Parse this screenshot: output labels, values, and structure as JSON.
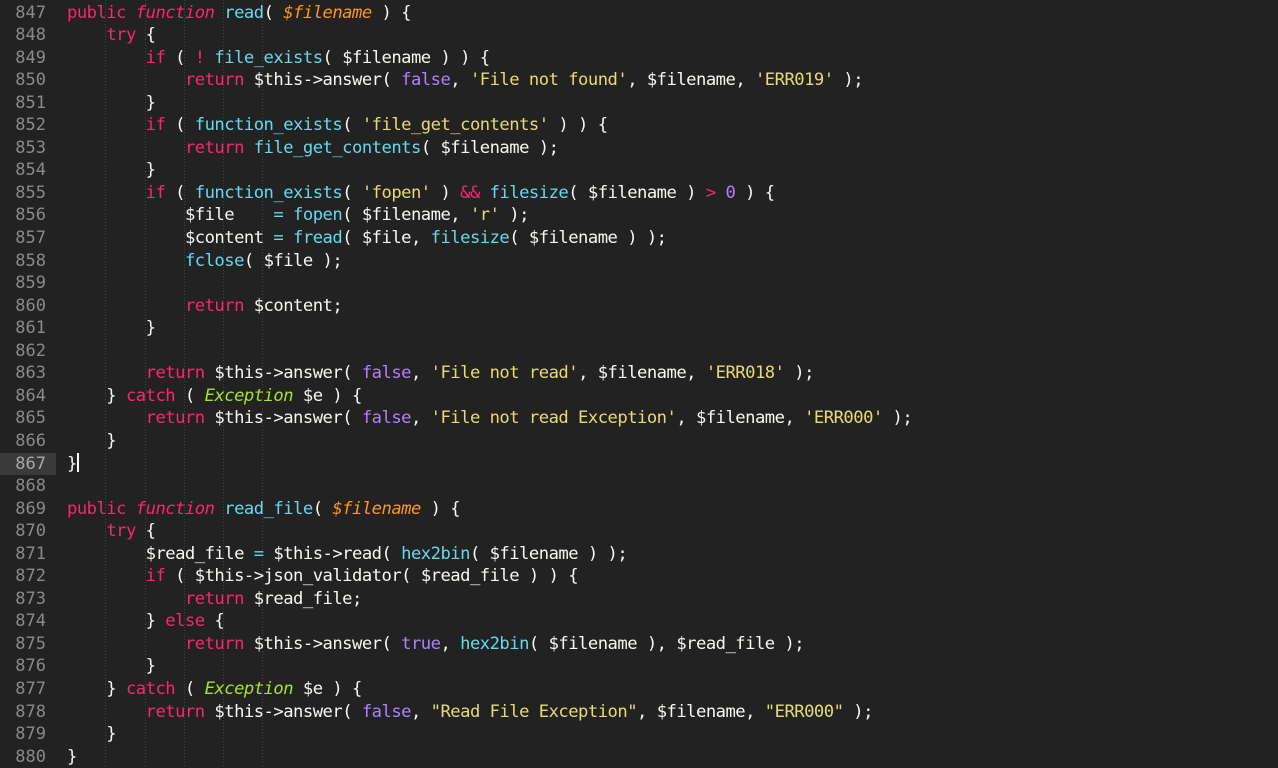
{
  "editor": {
    "background_color": "#222222",
    "gutter_text_color": "#8a8a8a",
    "active_line_background": "#3a3a3a",
    "default_text_color": "#f8f8f2",
    "language": "PHP",
    "first_line_number": 847,
    "last_line_number": 880,
    "active_line_number": 867,
    "cursor_line": 867,
    "cursor_column": 2,
    "palette": {
      "keyword": "#f92672",
      "function_name": "#66d9ef",
      "string": "#e6db74",
      "constant": "#ae81ff",
      "class_name": "#a6e22e",
      "parameter": "#fd971f",
      "punctuation": "#f8f8f2"
    },
    "indent_guide_columns": [
      4,
      8,
      12,
      16,
      20
    ]
  },
  "code": {
    "lines": [
      {
        "num": "847",
        "text": "public function read( $filename ) {"
      },
      {
        "num": "848",
        "text": "    try {"
      },
      {
        "num": "849",
        "text": "        if ( ! file_exists( $filename ) ) {"
      },
      {
        "num": "850",
        "text": "            return $this->answer( false, 'File not found', $filename, 'ERR019' );"
      },
      {
        "num": "851",
        "text": "        }"
      },
      {
        "num": "852",
        "text": "        if ( function_exists( 'file_get_contents' ) ) {"
      },
      {
        "num": "853",
        "text": "            return file_get_contents( $filename );"
      },
      {
        "num": "854",
        "text": "        }"
      },
      {
        "num": "855",
        "text": "        if ( function_exists( 'fopen' ) && filesize( $filename ) > 0 ) {"
      },
      {
        "num": "856",
        "text": "            $file    = fopen( $filename, 'r' );"
      },
      {
        "num": "857",
        "text": "            $content = fread( $file, filesize( $filename ) );"
      },
      {
        "num": "858",
        "text": "            fclose( $file );"
      },
      {
        "num": "859",
        "text": ""
      },
      {
        "num": "860",
        "text": "            return $content;"
      },
      {
        "num": "861",
        "text": "        }"
      },
      {
        "num": "862",
        "text": ""
      },
      {
        "num": "863",
        "text": "        return $this->answer( false, 'File not read', $filename, 'ERR018' );"
      },
      {
        "num": "864",
        "text": "    } catch ( Exception $e ) {"
      },
      {
        "num": "865",
        "text": "        return $this->answer( false, 'File not read Exception', $filename, 'ERR000' );"
      },
      {
        "num": "866",
        "text": "    }"
      },
      {
        "num": "867",
        "text": "}"
      },
      {
        "num": "868",
        "text": ""
      },
      {
        "num": "869",
        "text": "public function read_file( $filename ) {"
      },
      {
        "num": "870",
        "text": "    try {"
      },
      {
        "num": "871",
        "text": "        $read_file = $this->read( hex2bin( $filename ) );"
      },
      {
        "num": "872",
        "text": "        if ( $this->json_validator( $read_file ) ) {"
      },
      {
        "num": "873",
        "text": "            return $read_file;"
      },
      {
        "num": "874",
        "text": "        } else {"
      },
      {
        "num": "875",
        "text": "            return $this->answer( true, hex2bin( $filename ), $read_file );"
      },
      {
        "num": "876",
        "text": "        }"
      },
      {
        "num": "877",
        "text": "    } catch ( Exception $e ) {"
      },
      {
        "num": "878",
        "text": "        return $this->answer( false, \"Read File Exception\", $filename, \"ERR000\" );"
      },
      {
        "num": "879",
        "text": "    }"
      },
      {
        "num": "880",
        "text": "}"
      }
    ],
    "tokens": [
      [
        [
          "kw",
          "public"
        ],
        [
          "pun",
          " "
        ],
        [
          "fnkw",
          "function"
        ],
        [
          "pun",
          " "
        ],
        [
          "fn",
          "read"
        ],
        [
          "pun",
          "( "
        ],
        [
          "param",
          "$filename"
        ],
        [
          "pun",
          " ) {"
        ]
      ],
      [
        [
          "pun",
          "    "
        ],
        [
          "kw",
          "try"
        ],
        [
          "pun",
          " {"
        ]
      ],
      [
        [
          "pun",
          "        "
        ],
        [
          "kw",
          "if"
        ],
        [
          "pun",
          " ( "
        ],
        [
          "op",
          "!"
        ],
        [
          "pun",
          " "
        ],
        [
          "fn",
          "file_exists"
        ],
        [
          "pun",
          "( "
        ],
        [
          "var",
          "$filename"
        ],
        [
          "pun",
          " ) ) {"
        ]
      ],
      [
        [
          "pun",
          "            "
        ],
        [
          "kw",
          "return"
        ],
        [
          "pun",
          " "
        ],
        [
          "var",
          "$this->answer"
        ],
        [
          "pun",
          "( "
        ],
        [
          "const",
          "false"
        ],
        [
          "pun",
          ", "
        ],
        [
          "str",
          "'File not found'"
        ],
        [
          "pun",
          ", "
        ],
        [
          "var",
          "$filename"
        ],
        [
          "pun",
          ", "
        ],
        [
          "str",
          "'ERR019'"
        ],
        [
          "pun",
          " );"
        ]
      ],
      [
        [
          "pun",
          "        }"
        ]
      ],
      [
        [
          "pun",
          "        "
        ],
        [
          "kw",
          "if"
        ],
        [
          "pun",
          " ( "
        ],
        [
          "fn",
          "function_exists"
        ],
        [
          "pun",
          "( "
        ],
        [
          "str",
          "'file_get_contents'"
        ],
        [
          "pun",
          " ) ) {"
        ]
      ],
      [
        [
          "pun",
          "            "
        ],
        [
          "kw",
          "return"
        ],
        [
          "pun",
          " "
        ],
        [
          "fn",
          "file_get_contents"
        ],
        [
          "pun",
          "( "
        ],
        [
          "var",
          "$filename"
        ],
        [
          "pun",
          " );"
        ]
      ],
      [
        [
          "pun",
          "        }"
        ]
      ],
      [
        [
          "pun",
          "        "
        ],
        [
          "kw",
          "if"
        ],
        [
          "pun",
          " ( "
        ],
        [
          "fn",
          "function_exists"
        ],
        [
          "pun",
          "( "
        ],
        [
          "str",
          "'fopen'"
        ],
        [
          "pun",
          " ) "
        ],
        [
          "op",
          "&&"
        ],
        [
          "pun",
          " "
        ],
        [
          "fn",
          "filesize"
        ],
        [
          "pun",
          "( "
        ],
        [
          "var",
          "$filename"
        ],
        [
          "pun",
          " ) "
        ],
        [
          "op",
          ">"
        ],
        [
          "pun",
          " "
        ],
        [
          "const",
          "0"
        ],
        [
          "pun",
          " ) {"
        ]
      ],
      [
        [
          "pun",
          "            "
        ],
        [
          "var",
          "$file"
        ],
        [
          "pun",
          "    "
        ],
        [
          "eq",
          "="
        ],
        [
          "pun",
          " "
        ],
        [
          "fn",
          "fopen"
        ],
        [
          "pun",
          "( "
        ],
        [
          "var",
          "$filename"
        ],
        [
          "pun",
          ", "
        ],
        [
          "str",
          "'r'"
        ],
        [
          "pun",
          " );"
        ]
      ],
      [
        [
          "pun",
          "            "
        ],
        [
          "var",
          "$content"
        ],
        [
          "pun",
          " "
        ],
        [
          "eq",
          "="
        ],
        [
          "pun",
          " "
        ],
        [
          "fn",
          "fread"
        ],
        [
          "pun",
          "( "
        ],
        [
          "var",
          "$file"
        ],
        [
          "pun",
          ", "
        ],
        [
          "fn",
          "filesize"
        ],
        [
          "pun",
          "( "
        ],
        [
          "var",
          "$filename"
        ],
        [
          "pun",
          " ) );"
        ]
      ],
      [
        [
          "pun",
          "            "
        ],
        [
          "fn",
          "fclose"
        ],
        [
          "pun",
          "( "
        ],
        [
          "var",
          "$file"
        ],
        [
          "pun",
          " );"
        ]
      ],
      [
        [
          "pun",
          ""
        ]
      ],
      [
        [
          "pun",
          "            "
        ],
        [
          "kw",
          "return"
        ],
        [
          "pun",
          " "
        ],
        [
          "var",
          "$content"
        ],
        [
          "pun",
          ";"
        ]
      ],
      [
        [
          "pun",
          "        }"
        ]
      ],
      [
        [
          "pun",
          ""
        ]
      ],
      [
        [
          "pun",
          "        "
        ],
        [
          "kw",
          "return"
        ],
        [
          "pun",
          " "
        ],
        [
          "var",
          "$this->answer"
        ],
        [
          "pun",
          "( "
        ],
        [
          "const",
          "false"
        ],
        [
          "pun",
          ", "
        ],
        [
          "str",
          "'File not read'"
        ],
        [
          "pun",
          ", "
        ],
        [
          "var",
          "$filename"
        ],
        [
          "pun",
          ", "
        ],
        [
          "str",
          "'ERR018'"
        ],
        [
          "pun",
          " );"
        ]
      ],
      [
        [
          "pun",
          "    } "
        ],
        [
          "kw",
          "catch"
        ],
        [
          "pun",
          " ( "
        ],
        [
          "cls",
          "Exception"
        ],
        [
          "pun",
          " "
        ],
        [
          "var",
          "$e"
        ],
        [
          "pun",
          " ) {"
        ]
      ],
      [
        [
          "pun",
          "        "
        ],
        [
          "kw",
          "return"
        ],
        [
          "pun",
          " "
        ],
        [
          "var",
          "$this->answer"
        ],
        [
          "pun",
          "( "
        ],
        [
          "const",
          "false"
        ],
        [
          "pun",
          ", "
        ],
        [
          "str",
          "'File not read Exception'"
        ],
        [
          "pun",
          ", "
        ],
        [
          "var",
          "$filename"
        ],
        [
          "pun",
          ", "
        ],
        [
          "str",
          "'ERR000'"
        ],
        [
          "pun",
          " );"
        ]
      ],
      [
        [
          "pun",
          "    }"
        ]
      ],
      [
        [
          "pun",
          "}"
        ],
        [
          "cursor",
          ""
        ]
      ],
      [
        [
          "pun",
          ""
        ]
      ],
      [
        [
          "kw",
          "public"
        ],
        [
          "pun",
          " "
        ],
        [
          "fnkw",
          "function"
        ],
        [
          "pun",
          " "
        ],
        [
          "fn",
          "read_file"
        ],
        [
          "pun",
          "( "
        ],
        [
          "param",
          "$filename"
        ],
        [
          "pun",
          " ) {"
        ]
      ],
      [
        [
          "pun",
          "    "
        ],
        [
          "kw",
          "try"
        ],
        [
          "pun",
          " {"
        ]
      ],
      [
        [
          "pun",
          "        "
        ],
        [
          "var",
          "$read_file"
        ],
        [
          "pun",
          " "
        ],
        [
          "eq",
          "="
        ],
        [
          "pun",
          " "
        ],
        [
          "var",
          "$this->read"
        ],
        [
          "pun",
          "( "
        ],
        [
          "fn",
          "hex2bin"
        ],
        [
          "pun",
          "( "
        ],
        [
          "var",
          "$filename"
        ],
        [
          "pun",
          " ) );"
        ]
      ],
      [
        [
          "pun",
          "        "
        ],
        [
          "kw",
          "if"
        ],
        [
          "pun",
          " ( "
        ],
        [
          "var",
          "$this->json_validator"
        ],
        [
          "pun",
          "( "
        ],
        [
          "var",
          "$read_file"
        ],
        [
          "pun",
          " ) ) {"
        ]
      ],
      [
        [
          "pun",
          "            "
        ],
        [
          "kw",
          "return"
        ],
        [
          "pun",
          " "
        ],
        [
          "var",
          "$read_file"
        ],
        [
          "pun",
          ";"
        ]
      ],
      [
        [
          "pun",
          "        } "
        ],
        [
          "kw",
          "else"
        ],
        [
          "pun",
          " {"
        ]
      ],
      [
        [
          "pun",
          "            "
        ],
        [
          "kw",
          "return"
        ],
        [
          "pun",
          " "
        ],
        [
          "var",
          "$this->answer"
        ],
        [
          "pun",
          "( "
        ],
        [
          "const",
          "true"
        ],
        [
          "pun",
          ", "
        ],
        [
          "fn",
          "hex2bin"
        ],
        [
          "pun",
          "( "
        ],
        [
          "var",
          "$filename"
        ],
        [
          "pun",
          " ), "
        ],
        [
          "var",
          "$read_file"
        ],
        [
          "pun",
          " );"
        ]
      ],
      [
        [
          "pun",
          "        }"
        ]
      ],
      [
        [
          "pun",
          "    } "
        ],
        [
          "kw",
          "catch"
        ],
        [
          "pun",
          " ( "
        ],
        [
          "cls",
          "Exception"
        ],
        [
          "pun",
          " "
        ],
        [
          "var",
          "$e"
        ],
        [
          "pun",
          " ) {"
        ]
      ],
      [
        [
          "pun",
          "        "
        ],
        [
          "kw",
          "return"
        ],
        [
          "pun",
          " "
        ],
        [
          "var",
          "$this->answer"
        ],
        [
          "pun",
          "( "
        ],
        [
          "const",
          "false"
        ],
        [
          "pun",
          ", "
        ],
        [
          "str",
          "\"Read File Exception\""
        ],
        [
          "pun",
          ", "
        ],
        [
          "var",
          "$filename"
        ],
        [
          "pun",
          ", "
        ],
        [
          "str",
          "\"ERR000\""
        ],
        [
          "pun",
          " );"
        ]
      ],
      [
        [
          "pun",
          "    }"
        ]
      ],
      [
        [
          "pun",
          "}"
        ]
      ]
    ]
  }
}
